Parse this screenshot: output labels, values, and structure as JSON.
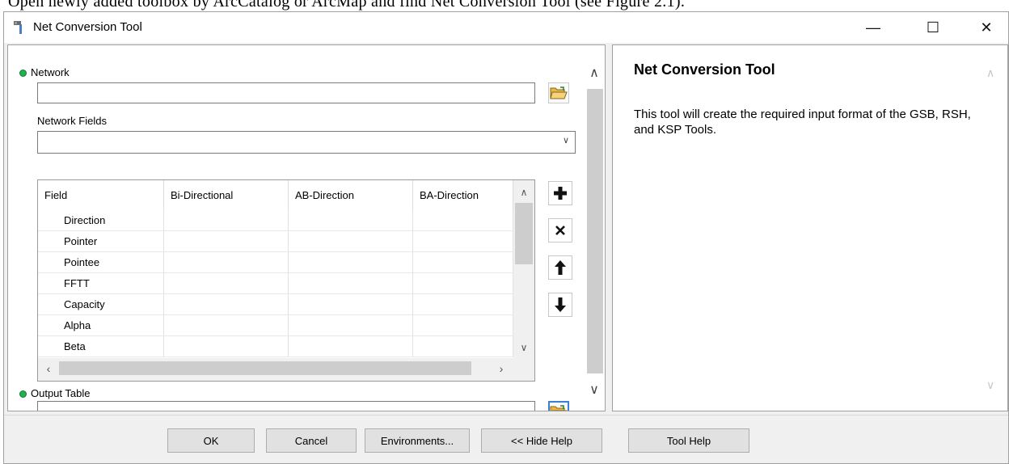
{
  "background_text": "Open newly added toolbox by ArcCatalog or ArcMap and find Net Conversion Tool (see Figure 2.1).",
  "window": {
    "title": "Net Conversion Tool",
    "icon": "hammer-tool-icon",
    "controls": {
      "minimize": "—",
      "maximize": "☐",
      "close": "✕"
    }
  },
  "params": {
    "network": {
      "label": "Network",
      "value": "",
      "required": true
    },
    "network_fields": {
      "label": "Network Fields",
      "value": ""
    },
    "output_table": {
      "label": "Output Table",
      "value": "",
      "required": true
    }
  },
  "field_table": {
    "columns": [
      "Field",
      "Bi-Directional",
      "AB-Direction",
      "BA-Direction"
    ],
    "rows": [
      [
        "Direction",
        "",
        "",
        ""
      ],
      [
        "Pointer",
        "",
        "",
        ""
      ],
      [
        "Pointee",
        "",
        "",
        ""
      ],
      [
        "FFTT",
        "",
        "",
        ""
      ],
      [
        "Capacity",
        "",
        "",
        ""
      ],
      [
        "Alpha",
        "",
        "",
        ""
      ],
      [
        "Beta",
        "",
        "",
        ""
      ]
    ]
  },
  "table_buttons": [
    "add-icon",
    "remove-icon",
    "move-up-icon",
    "move-down-icon"
  ],
  "help": {
    "title": "Net Conversion Tool",
    "body": "This tool will create the required input format of the GSB, RSH, and KSP Tools."
  },
  "buttons": {
    "ok": "OK",
    "cancel": "Cancel",
    "environments": "Environments...",
    "hide_help": "<< Hide Help",
    "tool_help": "Tool Help"
  },
  "colors": {
    "required_dot": "#22b14c",
    "focus_border": "#3a80d6",
    "window_bg": "#f0f0f0"
  }
}
